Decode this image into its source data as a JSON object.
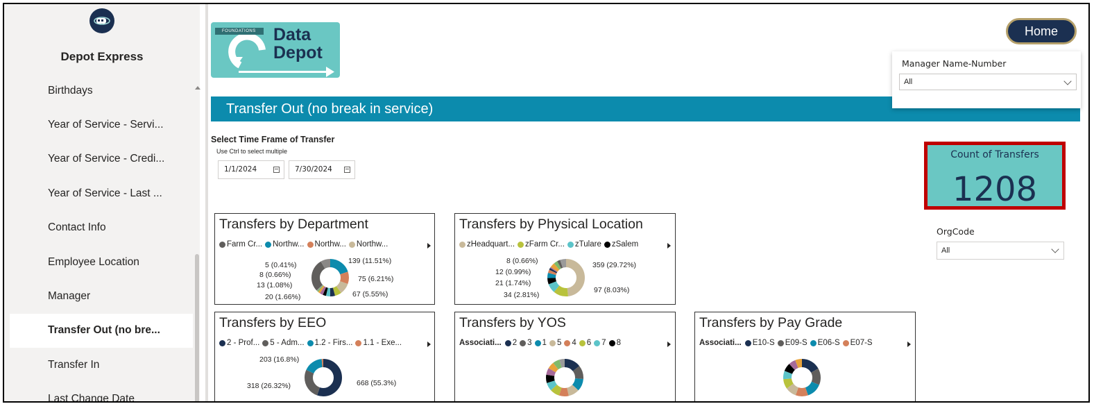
{
  "sidebar": {
    "title": "Depot Express",
    "items": [
      {
        "label": "Birthdays",
        "active": false
      },
      {
        "label": "Year of Service - Servi...",
        "active": false
      },
      {
        "label": "Year of Service - Credi...",
        "active": false
      },
      {
        "label": "Year of Service - Last ...",
        "active": false
      },
      {
        "label": "Contact Info",
        "active": false
      },
      {
        "label": "Employee Location",
        "active": false
      },
      {
        "label": "Manager",
        "active": false
      },
      {
        "label": "Transfer Out (no bre...",
        "active": true
      },
      {
        "label": "Transfer In",
        "active": false
      },
      {
        "label": "Last Change Date",
        "active": false
      }
    ]
  },
  "brand": {
    "org": "FOUNDATIONS",
    "line1": "Data",
    "line2": "Depot"
  },
  "header": {
    "home_label": "Home"
  },
  "manager_filter": {
    "label": "Manager Name-Number",
    "value": "All"
  },
  "banner": {
    "title": "Transfer Out (no break in service)"
  },
  "time_frame": {
    "title": "Select Time Frame of Transfer",
    "hint": "Use Ctrl to select multiple",
    "start": "1/1/2024",
    "end": "7/30/2024"
  },
  "kpi": {
    "label": "Count of Transfers",
    "value": "1208"
  },
  "org_filter": {
    "label": "OrgCode",
    "value": "All"
  },
  "cards": {
    "dept": {
      "title": "Transfers by Department",
      "legend": [
        {
          "label": "Farm Cr...",
          "color": "#605e5c"
        },
        {
          "label": "Northw...",
          "color": "#0c8bad"
        },
        {
          "label": "Northw...",
          "color": "#d4805a"
        },
        {
          "label": "Northw...",
          "color": "#c8b99a"
        }
      ],
      "labels": {
        "l1": "5 (0.41%)",
        "l2": "8 (0.66%)",
        "l3": "13 (1.08%)",
        "l4": "20 (1.66%)",
        "r1": "139 (11.51%)",
        "r2": "75 (6.21%)",
        "r3": "67 (5.55%)"
      }
    },
    "loc": {
      "title": "Transfers by Physical Location",
      "legend": [
        {
          "label": "zHeadquart...",
          "color": "#c8b99a"
        },
        {
          "label": "zFarm Cr...",
          "color": "#b8c23c"
        },
        {
          "label": "zTulare",
          "color": "#5cc4c9"
        },
        {
          "label": "zSalem",
          "color": "#000000"
        }
      ],
      "labels": {
        "l1": "8 (0.66%)",
        "l2": "12 (0.99%)",
        "l3": "21 (1.74%)",
        "l4": "34 (2.81%)",
        "r1": "359 (29.72%)",
        "r2": "97 (8.03%)"
      }
    },
    "eeo": {
      "title": "Transfers by EEO",
      "legend": [
        {
          "label": "2 - Prof...",
          "color": "#1b3051"
        },
        {
          "label": "5 - Adm...",
          "color": "#605e5c"
        },
        {
          "label": "1.2 - Firs...",
          "color": "#0c8bad"
        },
        {
          "label": "1.1 - Exe...",
          "color": "#d4805a"
        }
      ],
      "labels": {
        "l1": "203 (16.8%)",
        "l2": "318 (26.32%)",
        "r1": "668 (55.3%)"
      }
    },
    "yos": {
      "title": "Transfers by YOS",
      "legend_title": "Associati...",
      "legend": [
        {
          "label": "2",
          "color": "#1b3051"
        },
        {
          "label": "3",
          "color": "#605e5c"
        },
        {
          "label": "1",
          "color": "#0c8bad"
        },
        {
          "label": "5",
          "color": "#c8b99a"
        },
        {
          "label": "4",
          "color": "#d4805a"
        },
        {
          "label": "6",
          "color": "#b8c23c"
        },
        {
          "label": "7",
          "color": "#5cc4c9"
        },
        {
          "label": "8",
          "color": "#000000"
        }
      ]
    },
    "pay": {
      "title": "Transfers by Pay Grade",
      "legend_title": "Associati...",
      "legend": [
        {
          "label": "E10-S",
          "color": "#1b3051"
        },
        {
          "label": "E09-S",
          "color": "#605e5c"
        },
        {
          "label": "E06-S",
          "color": "#0c8bad"
        },
        {
          "label": "E07-S",
          "color": "#d4805a"
        }
      ]
    }
  }
}
